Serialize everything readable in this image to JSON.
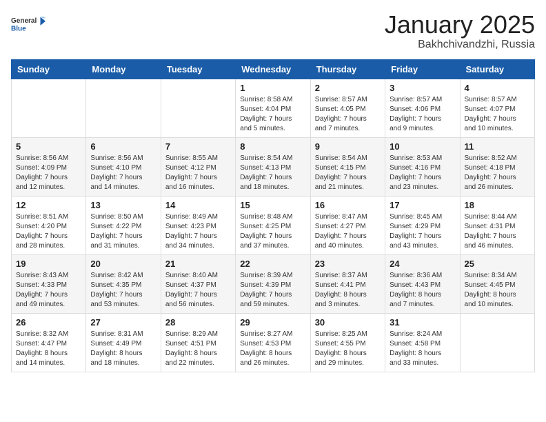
{
  "logo": {
    "general": "General",
    "blue": "Blue"
  },
  "header": {
    "title": "January 2025",
    "subtitle": "Bakhchivandzhi, Russia"
  },
  "days_of_week": [
    "Sunday",
    "Monday",
    "Tuesday",
    "Wednesday",
    "Thursday",
    "Friday",
    "Saturday"
  ],
  "weeks": [
    [
      {
        "day": "",
        "info": ""
      },
      {
        "day": "",
        "info": ""
      },
      {
        "day": "",
        "info": ""
      },
      {
        "day": "1",
        "info": "Sunrise: 8:58 AM\nSunset: 4:04 PM\nDaylight: 7 hours\nand 5 minutes."
      },
      {
        "day": "2",
        "info": "Sunrise: 8:57 AM\nSunset: 4:05 PM\nDaylight: 7 hours\nand 7 minutes."
      },
      {
        "day": "3",
        "info": "Sunrise: 8:57 AM\nSunset: 4:06 PM\nDaylight: 7 hours\nand 9 minutes."
      },
      {
        "day": "4",
        "info": "Sunrise: 8:57 AM\nSunset: 4:07 PM\nDaylight: 7 hours\nand 10 minutes."
      }
    ],
    [
      {
        "day": "5",
        "info": "Sunrise: 8:56 AM\nSunset: 4:09 PM\nDaylight: 7 hours\nand 12 minutes."
      },
      {
        "day": "6",
        "info": "Sunrise: 8:56 AM\nSunset: 4:10 PM\nDaylight: 7 hours\nand 14 minutes."
      },
      {
        "day": "7",
        "info": "Sunrise: 8:55 AM\nSunset: 4:12 PM\nDaylight: 7 hours\nand 16 minutes."
      },
      {
        "day": "8",
        "info": "Sunrise: 8:54 AM\nSunset: 4:13 PM\nDaylight: 7 hours\nand 18 minutes."
      },
      {
        "day": "9",
        "info": "Sunrise: 8:54 AM\nSunset: 4:15 PM\nDaylight: 7 hours\nand 21 minutes."
      },
      {
        "day": "10",
        "info": "Sunrise: 8:53 AM\nSunset: 4:16 PM\nDaylight: 7 hours\nand 23 minutes."
      },
      {
        "day": "11",
        "info": "Sunrise: 8:52 AM\nSunset: 4:18 PM\nDaylight: 7 hours\nand 26 minutes."
      }
    ],
    [
      {
        "day": "12",
        "info": "Sunrise: 8:51 AM\nSunset: 4:20 PM\nDaylight: 7 hours\nand 28 minutes."
      },
      {
        "day": "13",
        "info": "Sunrise: 8:50 AM\nSunset: 4:22 PM\nDaylight: 7 hours\nand 31 minutes."
      },
      {
        "day": "14",
        "info": "Sunrise: 8:49 AM\nSunset: 4:23 PM\nDaylight: 7 hours\nand 34 minutes."
      },
      {
        "day": "15",
        "info": "Sunrise: 8:48 AM\nSunset: 4:25 PM\nDaylight: 7 hours\nand 37 minutes."
      },
      {
        "day": "16",
        "info": "Sunrise: 8:47 AM\nSunset: 4:27 PM\nDaylight: 7 hours\nand 40 minutes."
      },
      {
        "day": "17",
        "info": "Sunrise: 8:45 AM\nSunset: 4:29 PM\nDaylight: 7 hours\nand 43 minutes."
      },
      {
        "day": "18",
        "info": "Sunrise: 8:44 AM\nSunset: 4:31 PM\nDaylight: 7 hours\nand 46 minutes."
      }
    ],
    [
      {
        "day": "19",
        "info": "Sunrise: 8:43 AM\nSunset: 4:33 PM\nDaylight: 7 hours\nand 49 minutes."
      },
      {
        "day": "20",
        "info": "Sunrise: 8:42 AM\nSunset: 4:35 PM\nDaylight: 7 hours\nand 53 minutes."
      },
      {
        "day": "21",
        "info": "Sunrise: 8:40 AM\nSunset: 4:37 PM\nDaylight: 7 hours\nand 56 minutes."
      },
      {
        "day": "22",
        "info": "Sunrise: 8:39 AM\nSunset: 4:39 PM\nDaylight: 7 hours\nand 59 minutes."
      },
      {
        "day": "23",
        "info": "Sunrise: 8:37 AM\nSunset: 4:41 PM\nDaylight: 8 hours\nand 3 minutes."
      },
      {
        "day": "24",
        "info": "Sunrise: 8:36 AM\nSunset: 4:43 PM\nDaylight: 8 hours\nand 7 minutes."
      },
      {
        "day": "25",
        "info": "Sunrise: 8:34 AM\nSunset: 4:45 PM\nDaylight: 8 hours\nand 10 minutes."
      }
    ],
    [
      {
        "day": "26",
        "info": "Sunrise: 8:32 AM\nSunset: 4:47 PM\nDaylight: 8 hours\nand 14 minutes."
      },
      {
        "day": "27",
        "info": "Sunrise: 8:31 AM\nSunset: 4:49 PM\nDaylight: 8 hours\nand 18 minutes."
      },
      {
        "day": "28",
        "info": "Sunrise: 8:29 AM\nSunset: 4:51 PM\nDaylight: 8 hours\nand 22 minutes."
      },
      {
        "day": "29",
        "info": "Sunrise: 8:27 AM\nSunset: 4:53 PM\nDaylight: 8 hours\nand 26 minutes."
      },
      {
        "day": "30",
        "info": "Sunrise: 8:25 AM\nSunset: 4:55 PM\nDaylight: 8 hours\nand 29 minutes."
      },
      {
        "day": "31",
        "info": "Sunrise: 8:24 AM\nSunset: 4:58 PM\nDaylight: 8 hours\nand 33 minutes."
      },
      {
        "day": "",
        "info": ""
      }
    ]
  ]
}
